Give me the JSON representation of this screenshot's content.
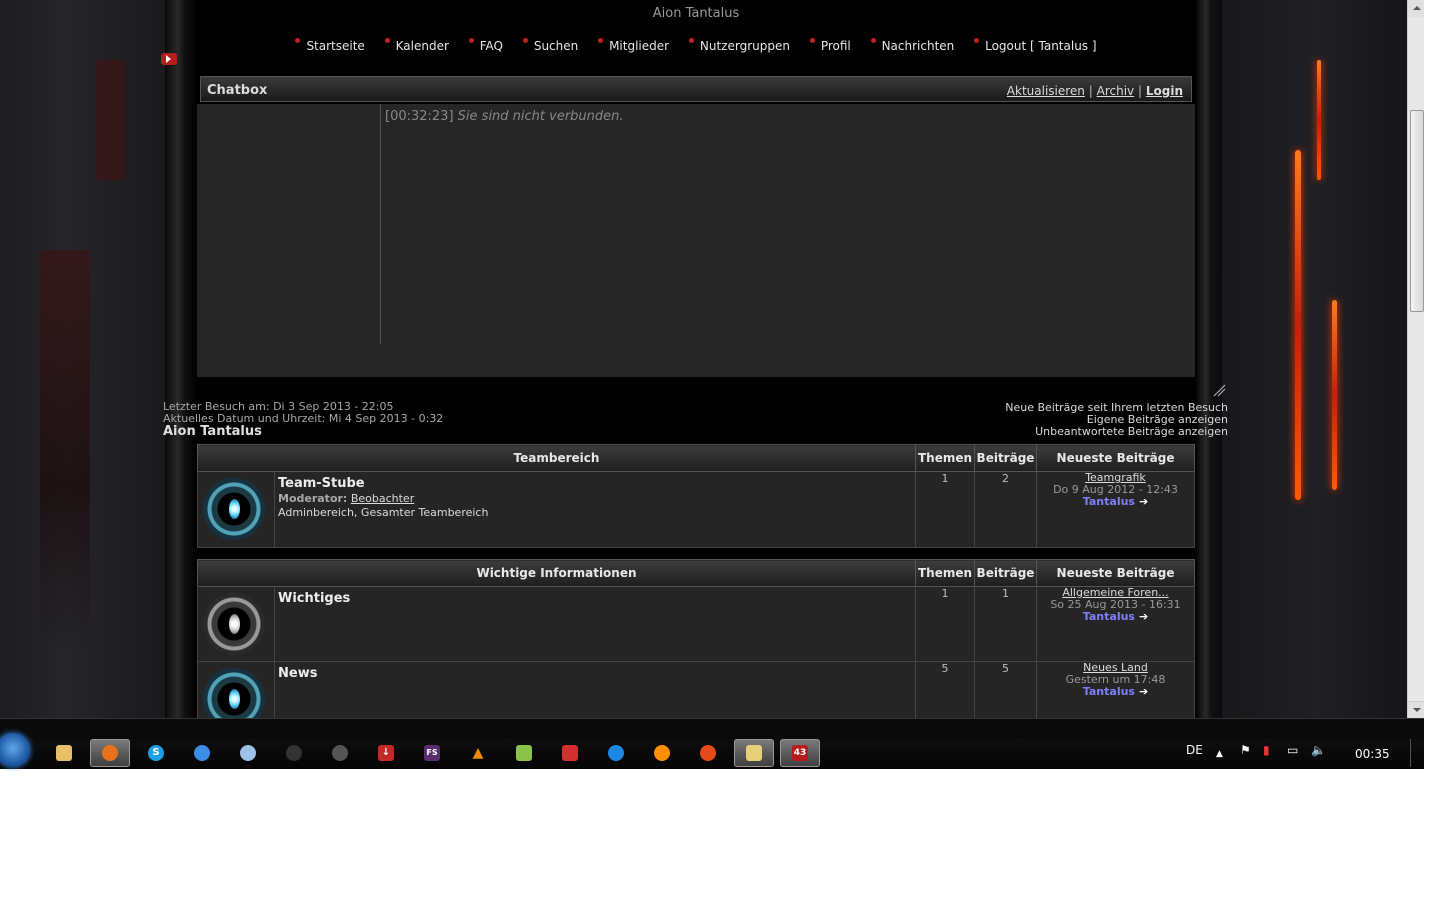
{
  "site": {
    "title": "Aion Tantalus"
  },
  "nav": [
    {
      "label": "Startseite"
    },
    {
      "label": "Kalender"
    },
    {
      "label": "FAQ"
    },
    {
      "label": "Suchen"
    },
    {
      "label": "Mitglieder"
    },
    {
      "label": "Nutzergruppen"
    },
    {
      "label": "Profil"
    },
    {
      "label": "Nachrichten"
    },
    {
      "label": "Logout [ Tantalus ]"
    }
  ],
  "chatbox": {
    "title": "Chatbox",
    "links": {
      "refresh": "Aktualisieren",
      "archive": "Archiv",
      "login": "Login",
      "separator": "|"
    },
    "message_time": "[00:32:23]",
    "message_text": "Sie sind nicht verbunden."
  },
  "visit_info": {
    "last_visit": "Letzter Besuch am: Di 3 Sep 2013 - 22:05",
    "current": "Aktuelles Datum und Uhrzeit: Mi 4 Sep 2013 - 0:32",
    "site_name": "Aion Tantalus"
  },
  "quick_links": {
    "new_posts": "Neue Beiträge seit Ihrem letzten Besuch",
    "own_posts": "Eigene Beiträge anzeigen",
    "unanswered": "Unbeantwortete Beiträge anzeigen"
  },
  "columns": {
    "topics": "Themen",
    "posts": "Beiträge",
    "latest": "Neueste Beiträge"
  },
  "categories": [
    {
      "name": "Teambereich",
      "forums": [
        {
          "name": "Team-Stube",
          "moderator_label": "Moderator:",
          "moderator": "Beobachter",
          "description": "Adminbereich, Gesamter Teambereich",
          "topics": "1",
          "posts": "2",
          "last_title": "Teamgrafik",
          "last_date": "Do 9 Aug 2012 - 12:43",
          "last_user": "Tantalus",
          "icon": "orb-blue-icon"
        }
      ]
    },
    {
      "name": "Wichtige Informationen",
      "forums": [
        {
          "name": "Wichtiges",
          "topics": "1",
          "posts": "1",
          "last_title": "Allgemeine Foren...",
          "last_date": "So 25 Aug 2013 - 16:31",
          "last_user": "Tantalus",
          "icon": "orb-grey-icon"
        },
        {
          "name": "News",
          "topics": "5",
          "posts": "5",
          "last_title": "Neues Land",
          "last_date": "Gestern um 17:48",
          "last_user": "Tantalus",
          "icon": "orb-blue-icon"
        }
      ]
    }
  ],
  "taskbar": {
    "lang": "DE",
    "clock": "00:35",
    "active_badge": "43",
    "fs_label": "FS"
  },
  "colors": {
    "accent_red": "#c02020",
    "user_link": "#7f7fff",
    "taskbar": "#0f0f0f"
  }
}
